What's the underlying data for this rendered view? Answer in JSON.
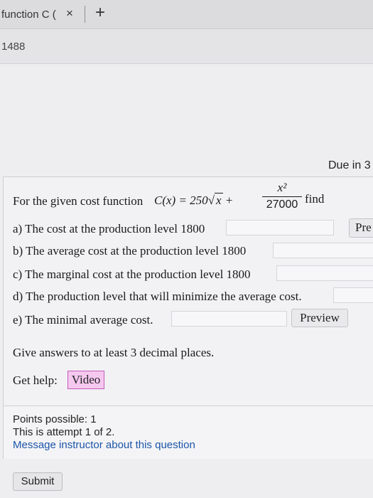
{
  "browser": {
    "tab_title": "function C (",
    "tab_close": "×",
    "new_tab": "+"
  },
  "header": {
    "assignment_id": "1488"
  },
  "due": {
    "text": "Due in 3"
  },
  "question": {
    "intro": "For the given cost function",
    "formula_lhs": "C(x) = 250",
    "sqrt_arg": "x",
    "plus": "+",
    "frac_num": "x²",
    "frac_den": "27000",
    "find": "find",
    "parts": [
      {
        "label": "a) The cost at the production level 1800",
        "value": ""
      },
      {
        "label": "b) The average cost at the production level 1800",
        "value": ""
      },
      {
        "label": "c) The marginal cost at the production level 1800",
        "value": ""
      },
      {
        "label": "d) The production level that will minimize the average cost.",
        "value": ""
      },
      {
        "label": "e) The minimal average cost.",
        "value": ""
      }
    ],
    "preview_label_a": "Pre",
    "preview_label_e": "Preview",
    "instructions": "Give answers to at least 3 decimal places.",
    "get_help": "Get help:",
    "video_label": "Video",
    "colors": {
      "video_bg": "#f5c8ef",
      "video_border": "#c45bb9"
    }
  },
  "points": {
    "possible": "Points possible: 1",
    "attempt": "This is attempt 1 of 2.",
    "message_link": "Message instructor about this question",
    "link_color": "#1c55a8"
  },
  "actions": {
    "submit_label": "Submit"
  }
}
